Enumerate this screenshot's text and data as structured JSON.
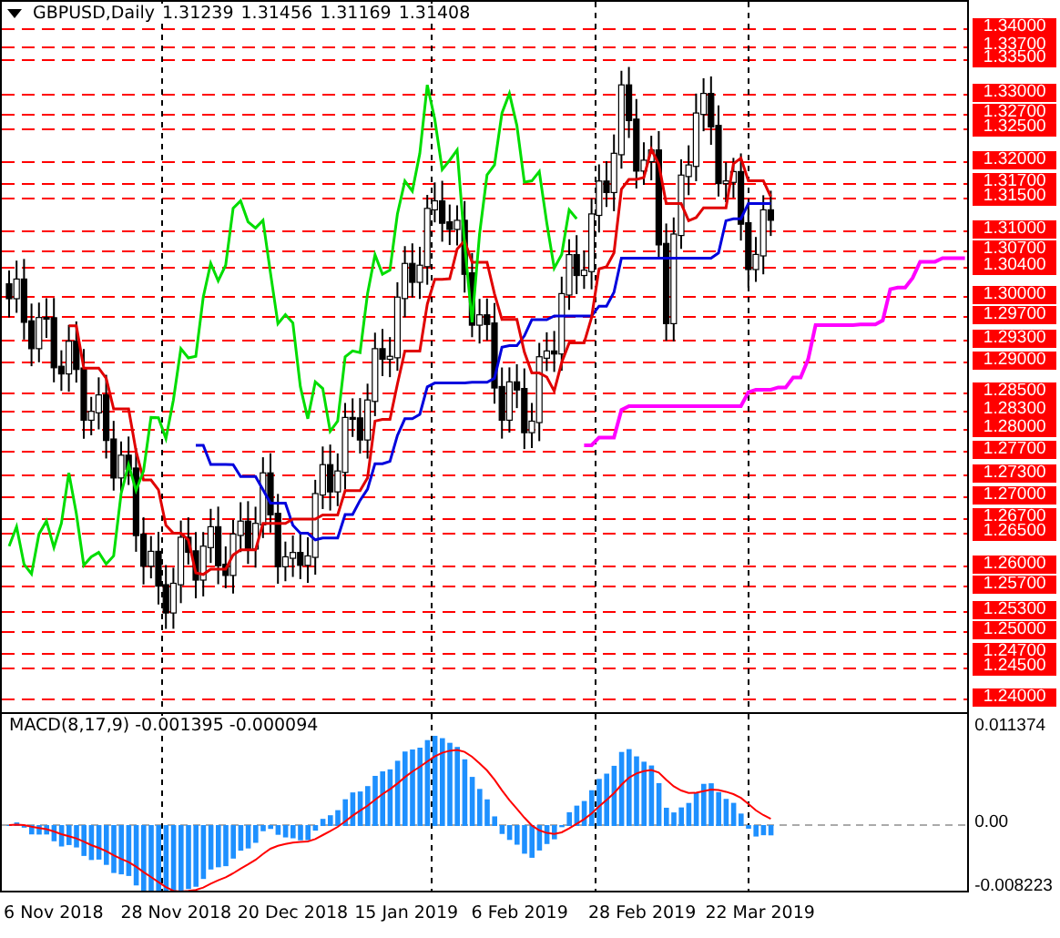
{
  "chart": {
    "symbol": "GBPUSD,Daily",
    "ohlc": [
      "1.31239",
      "1.31456",
      "1.31169",
      "1.31408"
    ],
    "price_axis": [
      "1.34000",
      "1.33700",
      "1.33500",
      "1.33000",
      "1.32700",
      "1.32500",
      "1.32000",
      "1.31700",
      "1.31500",
      "1.31000",
      "1.30700",
      "1.30400",
      "1.30000",
      "1.29700",
      "1.29300",
      "1.29000",
      "1.28500",
      "1.28300",
      "1.28000",
      "1.27700",
      "1.27300",
      "1.27000",
      "1.26700",
      "1.26500",
      "1.26000",
      "1.25700",
      "1.25300",
      "1.25000",
      "1.24700",
      "1.24500",
      "1.24000"
    ]
  },
  "macd": {
    "label": "MACD(8,17,9) -0.001395 -0.000094",
    "axis": [
      "0.011374",
      "0.00",
      "-0.008223"
    ]
  },
  "time_axis": [
    "6 Nov 2018",
    "28 Nov 2018",
    "20 Dec 2018",
    "15 Jan 2019",
    "6 Feb 2019",
    "28 Feb 2019",
    "22 Mar 2019"
  ]
}
